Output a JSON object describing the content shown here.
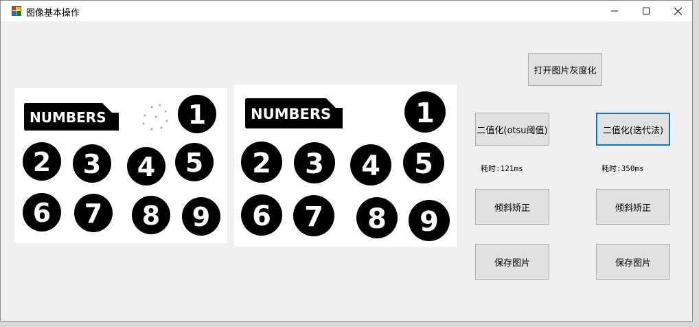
{
  "window": {
    "title": "图像基本操作"
  },
  "images": {
    "left": {
      "logo_text": "NUMBERS",
      "digits": [
        "1",
        "2",
        "3",
        "4",
        "5",
        "6",
        "7",
        "8",
        "9"
      ]
    },
    "right": {
      "logo_text": "NUMBERS",
      "digits": [
        "1",
        "2",
        "3",
        "4",
        "5",
        "6",
        "7",
        "8",
        "9"
      ]
    }
  },
  "buttons": {
    "open_gray": "打开图片灰度化",
    "otsu": "二值化(otsu阈值)",
    "iterative": "二值化(迭代法)",
    "deskew_left": "倾斜矫正",
    "deskew_right": "倾斜矫正",
    "save_left": "保存图片",
    "save_right": "保存图片"
  },
  "timing": {
    "left": "耗时:121ms",
    "right": "耗时:350ms"
  },
  "colors": {
    "focus_border": "#0078d7",
    "button_bg": "#e1e1e1"
  }
}
